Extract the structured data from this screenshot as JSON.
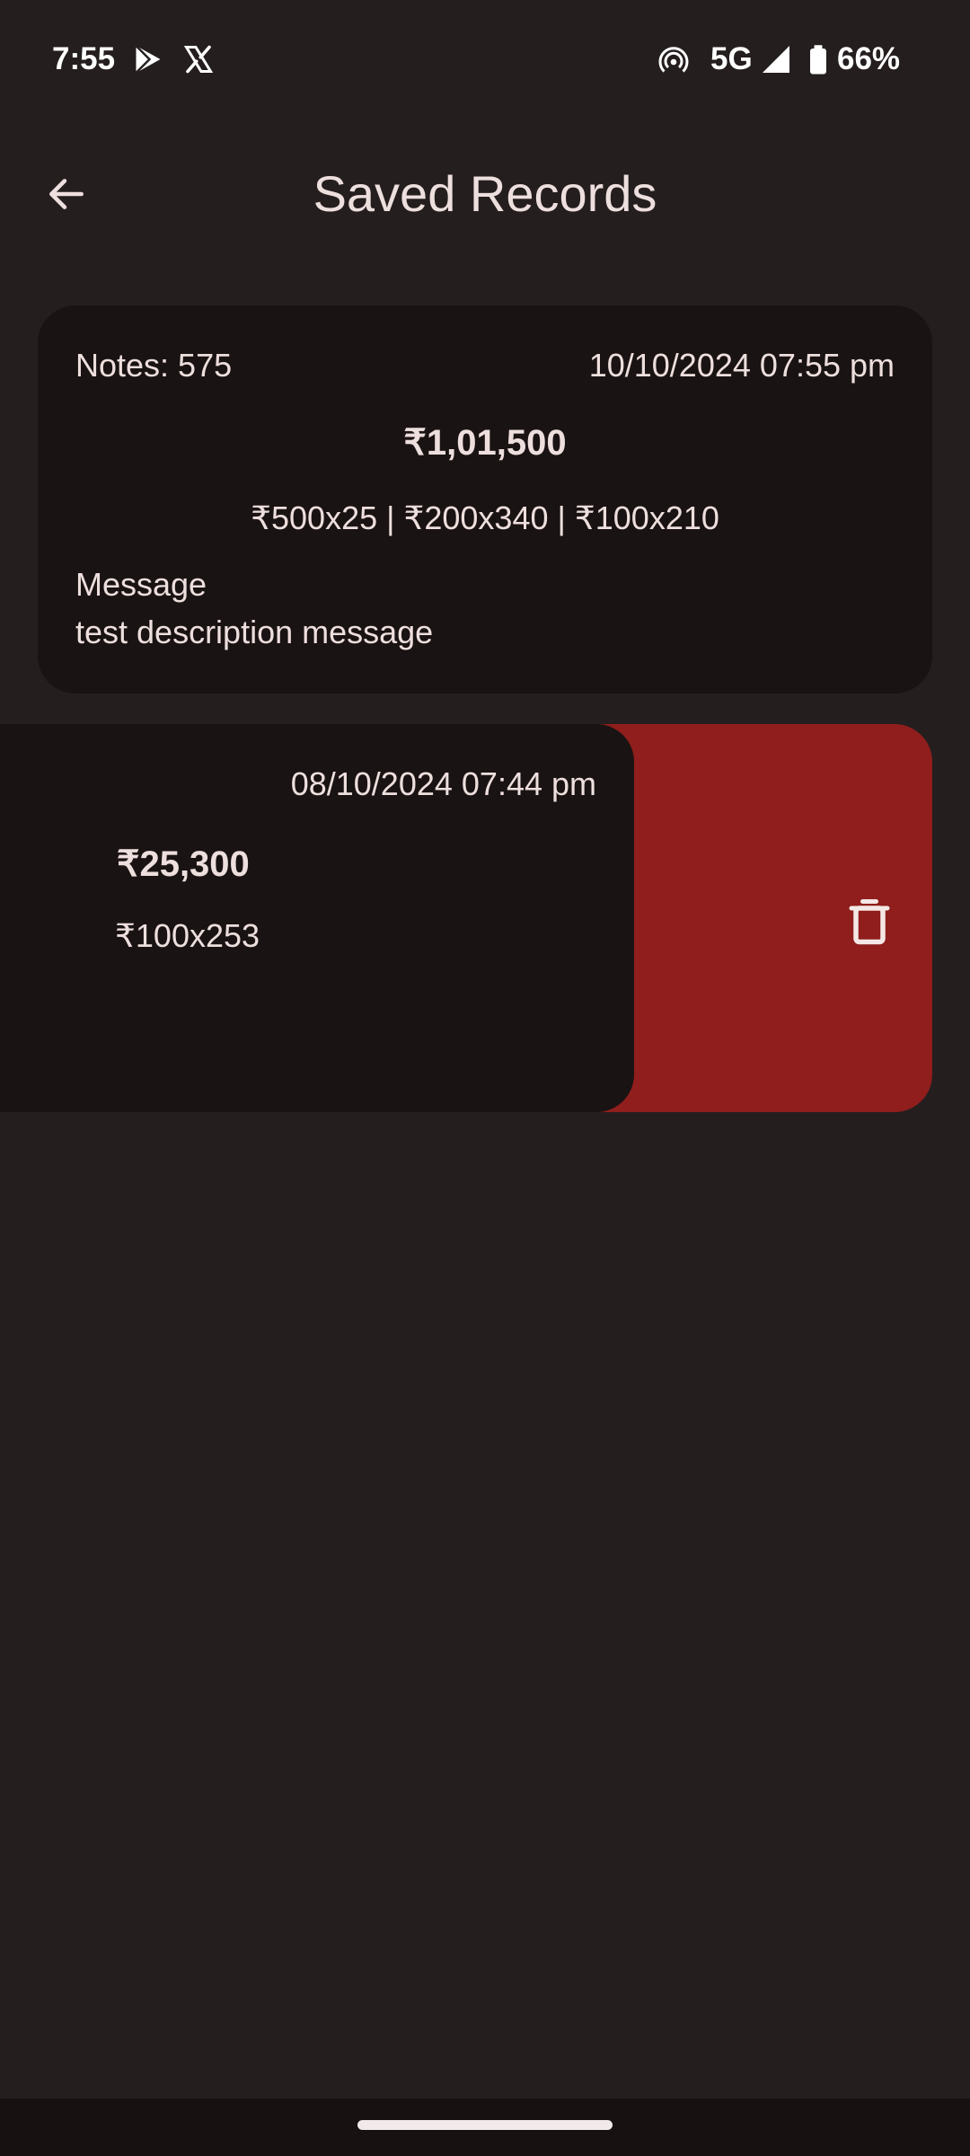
{
  "status_bar": {
    "time": "7:55",
    "network": "5G",
    "battery": "66%",
    "icons": [
      "play-store-icon",
      "x-logo-icon",
      "hotspot-icon",
      "signal-icon",
      "battery-icon"
    ]
  },
  "app_bar": {
    "title": "Saved Records",
    "back_icon": "arrow-left-icon"
  },
  "records": [
    {
      "notes": "Notes: 575",
      "datetime": "10/10/2024 07:55 pm",
      "amount": "₹1,01,500",
      "breakdown": "₹500x25 | ₹200x340 | ₹100x210",
      "message_label": "Message",
      "message": "test description message"
    },
    {
      "datetime": "08/10/2024 07:44 pm",
      "amount": "₹25,300",
      "breakdown": "₹100x253",
      "delete_icon": "trash-icon"
    }
  ],
  "colors": {
    "background": "#251e1e",
    "card": "#1a1313",
    "delete": "#8f1e1c",
    "text": "#eddfdd"
  }
}
